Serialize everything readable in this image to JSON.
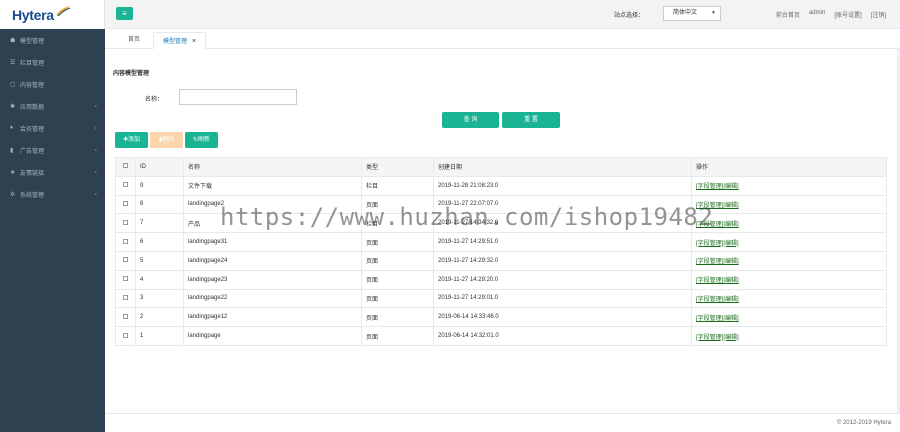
{
  "brand": {
    "logo_text": "Hytera",
    "accent": "#1ab394",
    "sidebar_bg": "#2f4050"
  },
  "sidebar": {
    "items": [
      {
        "label": "模型管理",
        "icon": "cube-icon",
        "glyph": "☗",
        "arrow": false
      },
      {
        "label": "栏目管理",
        "icon": "list-icon",
        "glyph": "☰",
        "arrow": false
      },
      {
        "label": "内容管理",
        "icon": "file-icon",
        "glyph": "▢",
        "arrow": false
      },
      {
        "label": "应用数据",
        "icon": "gear-icon",
        "glyph": "✱",
        "arrow": true
      },
      {
        "label": "会员管理",
        "icon": "users-icon",
        "glyph": "♦",
        "arrow": true
      },
      {
        "label": "广告管理",
        "icon": "chart-icon",
        "glyph": "▮",
        "arrow": true
      },
      {
        "label": "友情链接",
        "icon": "star-icon",
        "glyph": "★",
        "arrow": true
      },
      {
        "label": "系统管理",
        "icon": "cog-icon",
        "glyph": "✲",
        "arrow": true
      }
    ]
  },
  "header": {
    "site_label": "站点选择：",
    "site_value": "简体中文",
    "links": [
      "前台首页",
      "admin",
      "[账号设置]",
      "[注销]"
    ]
  },
  "tabs": [
    {
      "label": "首页"
    },
    {
      "label": "模型管理",
      "closable": true
    }
  ],
  "main": {
    "section_title": "内容模型管理",
    "form": {
      "name_label": "名称：",
      "name_value": "",
      "name_placeholder": ""
    },
    "buttons": {
      "query": "查 询",
      "reset": "重 置",
      "add": "✚添加",
      "delete": "▮删除",
      "refresh": "↻刷新"
    },
    "table": {
      "headers": [
        "ID",
        "名称",
        "类型",
        "创建日期",
        "操作"
      ],
      "rows": [
        {
          "id": "9",
          "name": "文件下载",
          "type": "栏目",
          "date": "2019-11-28 21:08:23.0"
        },
        {
          "id": "8",
          "name": "landingpage2",
          "type": "页面",
          "date": "2019-11-27 22:07:07.0"
        },
        {
          "id": "7",
          "name": "产品",
          "type": "栏目",
          "date": "2019-11-27 14:34:32.0"
        },
        {
          "id": "6",
          "name": "landingpage31",
          "type": "页面",
          "date": "2019-11-27 14:29:51.0"
        },
        {
          "id": "5",
          "name": "landingpage24",
          "type": "页面",
          "date": "2019-11-27 14:29:32.0"
        },
        {
          "id": "4",
          "name": "landingpage23",
          "type": "页面",
          "date": "2019-11-27 14:29:20.0"
        },
        {
          "id": "3",
          "name": "landingpage22",
          "type": "页面",
          "date": "2019-11-27 14:29:01.0"
        },
        {
          "id": "2",
          "name": "landingpage12",
          "type": "页面",
          "date": "2019-06-14 14:33:46.0"
        },
        {
          "id": "1",
          "name": "landingpage",
          "type": "页面",
          "date": "2019-06-14 14:32:01.0"
        }
      ],
      "op_field": "[字段管理]",
      "op_edit": "[编辑]"
    }
  },
  "footer": {
    "copyright": "© 2012-2019 Hytera"
  },
  "watermark": "https://www.huzhan.com/ishop19482"
}
